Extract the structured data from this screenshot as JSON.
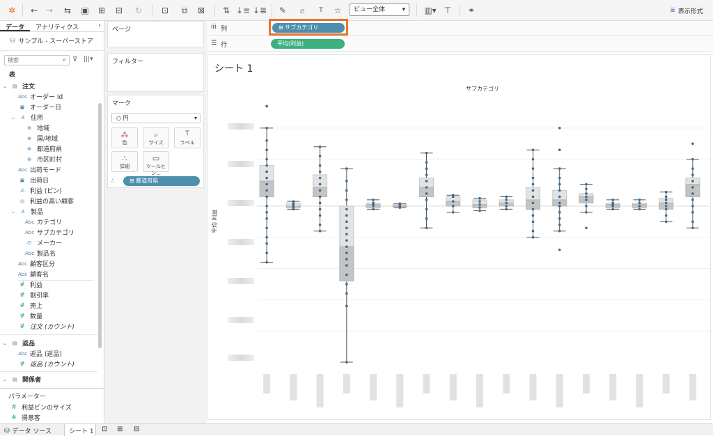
{
  "toolbar": {
    "view_select": "ビュー全体",
    "show_me": "表示形式"
  },
  "left_panel": {
    "tabs": [
      "データ",
      "アナリティクス"
    ],
    "datasource": "サンプル - スーパーストア",
    "search_placeholder": "検索",
    "section_table": "表",
    "fields": [
      {
        "caret": "⌄",
        "icon": "▤",
        "label": "注文",
        "bold": true,
        "indent": 4
      },
      {
        "icon": "Abc",
        "label": "オーダー Id",
        "indent": 26
      },
      {
        "icon": "▣",
        "label": "オーダー日",
        "indent": 26
      },
      {
        "caret": "⌄",
        "icon": "♙",
        "label": "住所",
        "indent": 16
      },
      {
        "icon": "⊕",
        "label": "地域",
        "indent": 36
      },
      {
        "icon": "⊕",
        "label": "国/地域",
        "indent": 36
      },
      {
        "icon": "⊕",
        "label": "都道府県",
        "indent": 36
      },
      {
        "icon": "⊕",
        "label": "市区町村",
        "indent": 36
      },
      {
        "icon": "Abc",
        "label": "出荷モード",
        "indent": 26
      },
      {
        "icon": "▣",
        "label": "出荷日",
        "indent": 26
      },
      {
        "icon": ".ıl.",
        "label": "利益 (ビン)",
        "indent": 26
      },
      {
        "icon": "◎",
        "label": "利益の高い顧客",
        "indent": 26
      },
      {
        "caret": "⌄",
        "icon": "♙",
        "label": "製品",
        "indent": 16
      },
      {
        "icon": "Abc",
        "label": "カテゴリ",
        "indent": 36
      },
      {
        "icon": "Abc",
        "label": "サブカテゴリ",
        "indent": 36
      },
      {
        "icon": "∅",
        "label": "メーカー",
        "indent": 36
      },
      {
        "icon": "Abc",
        "label": "製品名",
        "indent": 36
      },
      {
        "icon": "Abc",
        "label": "顧客区分",
        "indent": 26
      },
      {
        "icon": "Abc",
        "label": "顧客名",
        "indent": 26
      },
      {
        "icon": "#",
        "label": "利益",
        "indent": 26,
        "meas": true
      },
      {
        "icon": "#",
        "label": "割引率",
        "indent": 26,
        "meas": true
      },
      {
        "icon": "#",
        "label": "売上",
        "indent": 26,
        "meas": true
      },
      {
        "icon": "#",
        "label": "数量",
        "indent": 26,
        "meas": true
      },
      {
        "icon": "#",
        "label": "注文 (カウント)",
        "indent": 26,
        "meas": true,
        "italic": true
      }
    ],
    "returns_group": {
      "label": "返品"
    },
    "returns_fields": [
      {
        "icon": "Abc",
        "label": "返品 (返品)"
      },
      {
        "icon": "#",
        "label": "返品 (カウント)",
        "italic": true
      }
    ],
    "people_group": {
      "label": "関係者"
    },
    "parameters_title": "パラメーター",
    "parameters": [
      "利益ビンのサイズ",
      "得意客"
    ]
  },
  "middle_panel": {
    "pages_title": "ページ",
    "filters_title": "フィルター",
    "marks_title": "マーク",
    "mark_type": "円",
    "mark_buttons": [
      {
        "icon": "⁂",
        "label": "色"
      },
      {
        "icon": "⌕",
        "label": "サイズ"
      },
      {
        "icon": "T",
        "label": "ラベル"
      },
      {
        "icon": "∴",
        "label": "詳細"
      },
      {
        "icon": "▭",
        "label": "ツールヒン..."
      }
    ],
    "detail_pill": "都道府県"
  },
  "shelves": {
    "columns_label": "列",
    "rows_label": "行",
    "columns_pill": "サブカテゴリ",
    "rows_pill": "平均(利益)"
  },
  "sheet": {
    "title": "シート 1",
    "header": "サブカテゴリ",
    "yaxis_label": "平均 利益"
  },
  "bottom": {
    "datasource_tab": "データ ソース",
    "sheet_tab": "シート 1"
  },
  "colors": {
    "dimension_pill": "#4d8fad",
    "measure_pill": "#3db07f",
    "highlight": "#e8742c",
    "dot": "#3f6b8f"
  },
  "chart_data": {
    "type": "box",
    "xlabel": "サブカテゴリ",
    "ylabel": "平均 利益",
    "series": [
      {
        "whisker_low": -1.8,
        "q1": 0.3,
        "median": 0.8,
        "q3": 1.3,
        "whisker_high": 2.5,
        "outliers": [
          3.2
        ],
        "dots": [
          -1.8,
          -1.5,
          -1.2,
          -1.0,
          -0.7,
          -0.4,
          -0.2,
          0.0,
          0.3,
          0.5,
          0.7,
          0.9,
          1.1,
          1.3,
          1.5,
          1.8,
          2.1,
          2.5,
          3.2
        ]
      },
      {
        "whisker_low": -0.1,
        "q1": -0.05,
        "median": 0.0,
        "q3": 0.1,
        "whisker_high": 0.15,
        "outliers": [],
        "dots": [
          -0.1,
          -0.05,
          0.0,
          0.05,
          0.1,
          0.15
        ]
      },
      {
        "whisker_low": -0.8,
        "q1": 0.3,
        "median": 0.6,
        "q3": 1.0,
        "whisker_high": 1.9,
        "outliers": [],
        "dots": [
          -0.8,
          -0.6,
          -0.3,
          -0.1,
          0.1,
          0.3,
          0.5,
          0.7,
          0.9,
          1.1,
          1.3,
          1.6,
          1.9
        ]
      },
      {
        "whisker_low": -5.0,
        "q1": -2.4,
        "median": -1.3,
        "q3": 0.0,
        "whisker_high": 1.2,
        "outliers": [],
        "dots": [
          -5.0,
          -3.2,
          -2.8,
          -2.5,
          -2.2,
          -1.9,
          -1.7,
          -1.5,
          -1.3,
          -1.1,
          -0.9,
          -0.7,
          -0.5,
          -0.3,
          -0.1,
          0.2,
          0.5,
          0.8,
          1.2
        ]
      },
      {
        "whisker_low": -0.1,
        "q1": -0.05,
        "median": 0.05,
        "q3": 0.1,
        "whisker_high": 0.2,
        "outliers": [],
        "dots": [
          -0.1,
          0.0,
          0.05,
          0.1,
          0.2
        ]
      },
      {
        "whisker_low": -0.05,
        "q1": -0.02,
        "median": 0.02,
        "q3": 0.05,
        "whisker_high": 0.08,
        "outliers": [],
        "dots": [
          -0.05,
          0.0,
          0.05,
          0.08
        ]
      },
      {
        "whisker_low": -0.7,
        "q1": 0.3,
        "median": 0.6,
        "q3": 0.9,
        "whisker_high": 1.7,
        "outliers": [],
        "dots": [
          -0.7,
          -0.4,
          -0.1,
          0.2,
          0.4,
          0.6,
          0.8,
          1.0,
          1.2,
          1.4,
          1.7
        ]
      },
      {
        "whisker_low": -0.2,
        "q1": 0.0,
        "median": 0.15,
        "q3": 0.3,
        "whisker_high": 0.35,
        "outliers": [],
        "dots": [
          -0.2,
          0.0,
          0.15,
          0.3,
          0.35
        ]
      },
      {
        "whisker_low": -0.15,
        "q1": -0.05,
        "median": 0.05,
        "q3": 0.2,
        "whisker_high": 0.25,
        "outliers": [],
        "dots": [
          -0.15,
          -0.05,
          0.05,
          0.15,
          0.25
        ]
      },
      {
        "whisker_low": -0.1,
        "q1": 0.0,
        "median": 0.1,
        "q3": 0.2,
        "whisker_high": 0.3,
        "outliers": [],
        "dots": [
          -0.1,
          0.0,
          0.1,
          0.2,
          0.3
        ]
      },
      {
        "whisker_low": -1.0,
        "q1": -0.1,
        "median": 0.2,
        "q3": 0.6,
        "whisker_high": 1.8,
        "outliers": [],
        "dots": [
          -1.0,
          -0.8,
          -0.5,
          -0.3,
          -0.1,
          0.1,
          0.3,
          0.5,
          0.7,
          0.9,
          1.2,
          1.5,
          1.8
        ]
      },
      {
        "whisker_low": -0.8,
        "q1": 0.0,
        "median": 0.2,
        "q3": 0.5,
        "whisker_high": 1.2,
        "outliers": [
          2.5,
          -1.4
        ],
        "dots": [
          -1.4,
          -0.8,
          -0.6,
          -0.4,
          -0.2,
          0.0,
          0.1,
          0.3,
          0.5,
          0.7,
          0.9,
          1.2,
          1.8,
          2.5
        ]
      },
      {
        "whisker_low": -0.2,
        "q1": 0.1,
        "median": 0.3,
        "q3": 0.4,
        "whisker_high": 0.7,
        "outliers": [
          -0.7
        ],
        "dots": [
          -0.7,
          -0.2,
          0.0,
          0.2,
          0.3,
          0.4,
          0.55,
          0.7
        ]
      },
      {
        "whisker_low": -0.1,
        "q1": -0.05,
        "median": 0.05,
        "q3": 0.1,
        "whisker_high": 0.2,
        "outliers": [],
        "dots": [
          -0.1,
          0.0,
          0.05,
          0.1,
          0.2
        ]
      },
      {
        "whisker_low": -0.1,
        "q1": -0.05,
        "median": 0.05,
        "q3": 0.1,
        "whisker_high": 0.2,
        "outliers": [],
        "dots": [
          -0.1,
          0.0,
          0.1,
          0.2
        ]
      },
      {
        "whisker_low": -0.5,
        "q1": -0.1,
        "median": 0.1,
        "q3": 0.25,
        "whisker_high": 0.45,
        "outliers": [],
        "dots": [
          -0.5,
          -0.3,
          -0.1,
          0.0,
          0.1,
          0.2,
          0.3,
          0.45
        ]
      },
      {
        "whisker_low": -0.7,
        "q1": 0.3,
        "median": 0.7,
        "q3": 0.9,
        "whisker_high": 1.5,
        "outliers": [
          2.0
        ],
        "dots": [
          -0.7,
          -0.5,
          -0.2,
          0.0,
          0.2,
          0.4,
          0.6,
          0.8,
          1.0,
          1.2,
          1.5,
          2.0
        ]
      }
    ],
    "ylim": [
      -5.2,
      3.5
    ]
  }
}
